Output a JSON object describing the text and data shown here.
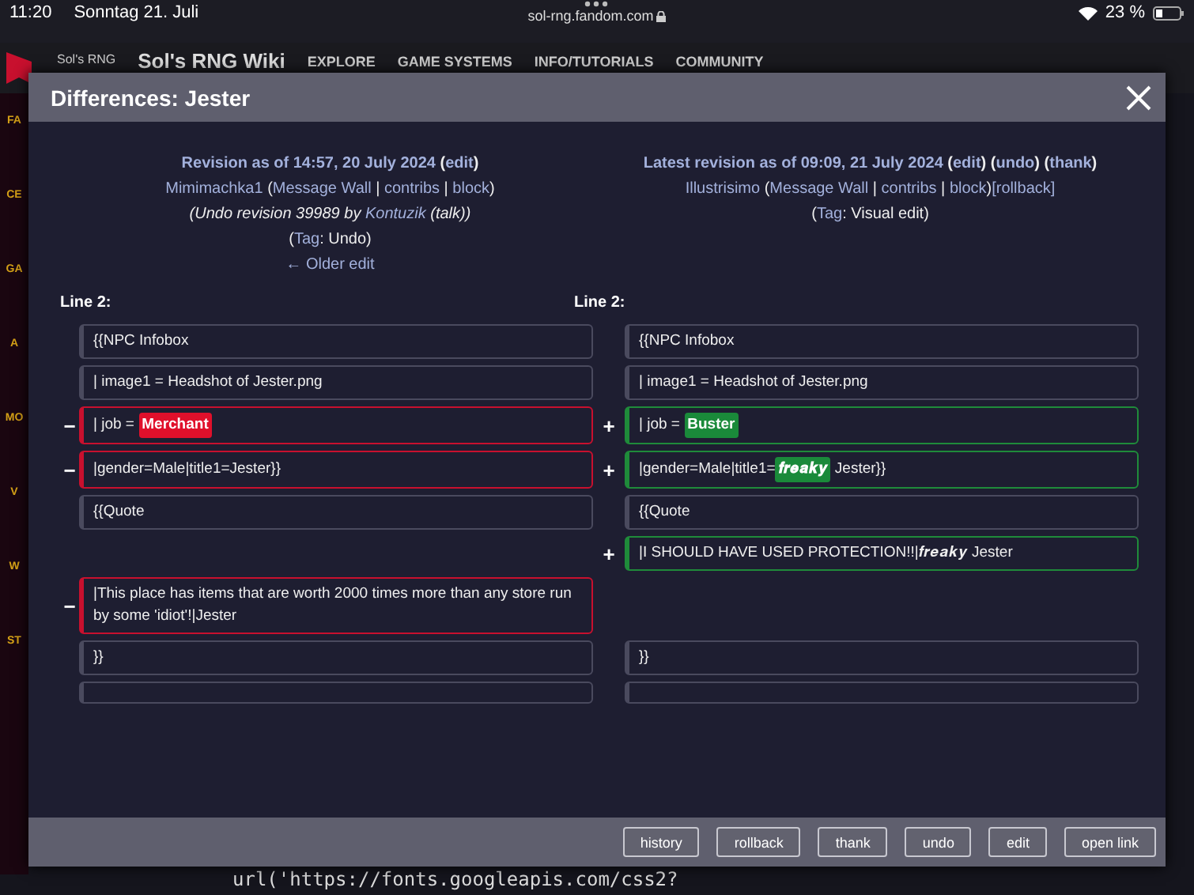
{
  "status_bar": {
    "time": "11:20",
    "date": "Sonntag 21. Juli",
    "url": "sol-rng.fandom.com",
    "battery": "23 %"
  },
  "wiki_header": {
    "brand_small": "Sol's RNG",
    "title": "Sol's RNG Wiki",
    "nav": [
      "EXPLORE",
      "GAME SYSTEMS",
      "INFO/TUTORIALS",
      "COMMUNITY"
    ]
  },
  "sidebar_fragments": [
    "FA",
    "CE",
    "GA",
    "A",
    "MO",
    "V",
    "W",
    "ST"
  ],
  "background_code": [
    "url('https://fonts.googleapis.com/css2?"
  ],
  "dialog": {
    "title": "Differences: Jester",
    "left_header": [
      {
        "kind": "title",
        "parts": [
          {
            "text": "Revision as of 14:57, 20 July 2024",
            "link": true
          },
          {
            "text": " (",
            "link": false
          },
          {
            "text": "edit",
            "link": true
          },
          {
            "text": ")",
            "link": false
          }
        ]
      },
      {
        "kind": "user",
        "parts": [
          {
            "text": "Mimimachka1",
            "link": true
          },
          {
            "text": " (",
            "link": false
          },
          {
            "text": "Message Wall",
            "link": true
          },
          {
            "text": " | ",
            "link": false
          },
          {
            "text": "contribs",
            "link": true
          },
          {
            "text": " | ",
            "link": false
          },
          {
            "text": "block",
            "link": true
          },
          {
            "text": ")",
            "link": false
          }
        ]
      },
      {
        "kind": "summary",
        "parts": [
          {
            "text": "(Undo revision 39989 by ",
            "link": false
          },
          {
            "text": "Kontuzik",
            "link": true
          },
          {
            "text": " (talk))",
            "link": false
          }
        ]
      },
      {
        "kind": "plain",
        "parts": [
          {
            "text": "(",
            "link": false
          },
          {
            "text": "Tag",
            "link": true
          },
          {
            "text": ": Undo)",
            "link": false
          }
        ]
      },
      {
        "kind": "plain",
        "parts": [
          {
            "text": "← Older edit",
            "link": true
          }
        ]
      }
    ],
    "right_header": [
      {
        "kind": "title",
        "parts": [
          {
            "text": "Latest revision as of 09:09, 21 July 2024",
            "link": true
          },
          {
            "text": " (",
            "link": false
          },
          {
            "text": "edit",
            "link": true
          },
          {
            "text": ") (",
            "link": false
          },
          {
            "text": "undo",
            "link": true
          },
          {
            "text": ") (",
            "link": false
          },
          {
            "text": "thank",
            "link": true
          },
          {
            "text": ")",
            "link": false
          }
        ]
      },
      {
        "kind": "user",
        "parts": [
          {
            "text": "Illustrisimo",
            "link": true
          },
          {
            "text": " (",
            "link": false
          },
          {
            "text": "Message Wall",
            "link": true
          },
          {
            "text": " | ",
            "link": false
          },
          {
            "text": "contribs",
            "link": true
          },
          {
            "text": " | ",
            "link": false
          },
          {
            "text": "block",
            "link": true
          },
          {
            "text": ")",
            "link": false
          },
          {
            "text": "[rollback]",
            "link": true
          }
        ]
      },
      {
        "kind": "plain",
        "parts": [
          {
            "text": "(",
            "link": false
          },
          {
            "text": "Tag",
            "link": true
          },
          {
            "text": ": Visual edit)",
            "link": false
          }
        ]
      }
    ],
    "left_line_label": "Line 2:",
    "right_line_label": "Line 2:",
    "rows": [
      {
        "left": {
          "kind": "context",
          "segments": [
            {
              "text": "{{NPC Infobox",
              "kind": "plain"
            }
          ]
        },
        "right": {
          "kind": "context",
          "segments": [
            {
              "text": "{{NPC Infobox",
              "kind": "plain"
            }
          ]
        }
      },
      {
        "left": {
          "kind": "context",
          "segments": [
            {
              "text": "| image1 = Headshot of Jester.png",
              "kind": "plain"
            }
          ]
        },
        "right": {
          "kind": "context",
          "segments": [
            {
              "text": "| image1 = Headshot of Jester.png",
              "kind": "plain"
            }
          ]
        }
      },
      {
        "left": {
          "kind": "deleted",
          "marker": "−",
          "segments": [
            {
              "text": "| job = ",
              "kind": "plain"
            },
            {
              "text": "Merchant",
              "kind": "changed"
            }
          ]
        },
        "right": {
          "kind": "added",
          "marker": "+",
          "segments": [
            {
              "text": "| job = ",
              "kind": "plain"
            },
            {
              "text": "Buster",
              "kind": "changed"
            }
          ]
        }
      },
      {
        "left": {
          "kind": "deleted",
          "marker": "−",
          "segments": [
            {
              "text": "|gender=Male|title1=Jester}}",
              "kind": "plain"
            }
          ]
        },
        "right": {
          "kind": "added",
          "marker": "+",
          "segments": [
            {
              "text": "|gender=Male|title1=",
              "kind": "plain"
            },
            {
              "text": "𝒇𝒓𝒆𝒂𝒌𝒚",
              "kind": "changed"
            },
            {
              "text": " Jester}}",
              "kind": "plain"
            }
          ]
        }
      },
      {
        "left": {
          "kind": "context",
          "segments": [
            {
              "text": "{{Quote",
              "kind": "plain"
            }
          ]
        },
        "right": {
          "kind": "context",
          "segments": [
            {
              "text": "{{Quote",
              "kind": "plain"
            }
          ]
        }
      },
      {
        "left": {
          "kind": "none"
        },
        "right": {
          "kind": "added",
          "marker": "+",
          "segments": [
            {
              "text": "|I SHOULD HAVE USED PROTECTION!!|",
              "kind": "plain"
            },
            {
              "text": "𝒇𝒓𝒆𝒂𝒌𝒚",
              "kind": "plain"
            },
            {
              "text": " Jester",
              "kind": "plain"
            }
          ]
        }
      },
      {
        "left": {
          "kind": "deleted",
          "marker": "−",
          "segments": [
            {
              "text": "|This place has items that are worth 2000 times more than any store run by some 'idiot'!|Jester",
              "kind": "plain"
            }
          ]
        },
        "right": {
          "kind": "none"
        }
      },
      {
        "left": {
          "kind": "context",
          "segments": [
            {
              "text": "}}",
              "kind": "plain"
            }
          ]
        },
        "right": {
          "kind": "context",
          "segments": [
            {
              "text": "}}",
              "kind": "plain"
            }
          ]
        }
      },
      {
        "left": {
          "kind": "context"
        },
        "right": {
          "kind": "context"
        }
      }
    ],
    "buttons": [
      "history",
      "rollback",
      "thank",
      "undo",
      "edit",
      "open link"
    ]
  }
}
